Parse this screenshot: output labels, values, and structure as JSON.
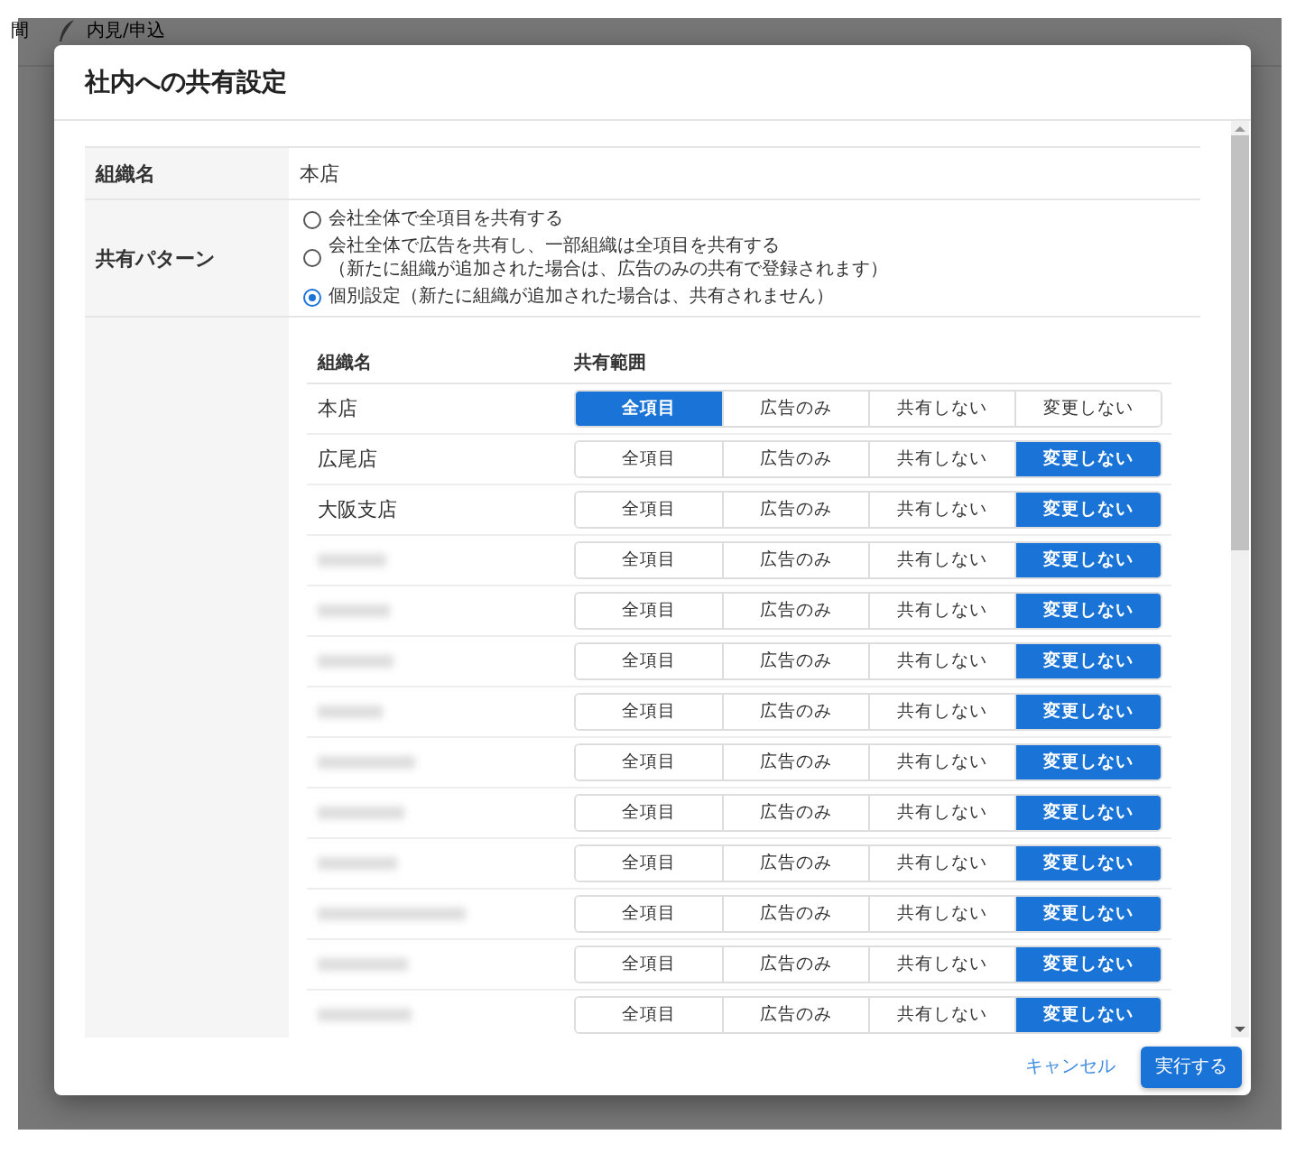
{
  "background": {
    "menu": [
      {
        "label": "間"
      },
      {
        "label": "内見/申込"
      }
    ]
  },
  "dialog": {
    "title": "社内への共有設定",
    "org_label": "組織名",
    "org_value": "本店",
    "pattern_label": "共有パターン",
    "patterns": [
      {
        "label": "会社全体で全項目を共有する",
        "selected": false
      },
      {
        "label": "会社全体で広告を共有し、一部組織は全項目を共有する",
        "note": "（新たに組織が追加された場合は、広告のみの共有で登録されます）",
        "selected": false
      },
      {
        "label": "個別設定（新たに組織が追加された場合は、共有されません）",
        "selected": true
      }
    ],
    "table": {
      "columns": [
        "組織名",
        "共有範囲"
      ],
      "rows": [
        {
          "kind": "named",
          "name": "本店",
          "options": [
            {
              "label": "全項目",
              "selected": true
            },
            {
              "label": "広告のみ",
              "selected": false
            },
            {
              "label": "共有しない",
              "selected": false
            },
            {
              "label": "変更しない",
              "selected": false
            }
          ]
        },
        {
          "kind": "named",
          "name": "広尾店",
          "options": [
            {
              "label": "全項目",
              "selected": false
            },
            {
              "label": "広告のみ",
              "selected": false
            },
            {
              "label": "共有しない",
              "selected": false
            },
            {
              "label": "変更しない",
              "selected": true
            }
          ]
        },
        {
          "kind": "named",
          "name": "大阪支店",
          "options": [
            {
              "label": "全項目",
              "selected": false
            },
            {
              "label": "広告のみ",
              "selected": false
            },
            {
              "label": "共有しない",
              "selected": false
            },
            {
              "label": "変更しない",
              "selected": true
            }
          ]
        },
        {
          "kind": "blurred",
          "options": [
            {
              "label": "全項目",
              "selected": false
            },
            {
              "label": "広告のみ",
              "selected": false
            },
            {
              "label": "共有しない",
              "selected": false
            },
            {
              "label": "変更しない",
              "selected": true
            }
          ]
        },
        {
          "kind": "blurred",
          "options": [
            {
              "label": "全項目",
              "selected": false
            },
            {
              "label": "広告のみ",
              "selected": false
            },
            {
              "label": "共有しない",
              "selected": false
            },
            {
              "label": "変更しない",
              "selected": true
            }
          ]
        },
        {
          "kind": "blurred",
          "options": [
            {
              "label": "全項目",
              "selected": false
            },
            {
              "label": "広告のみ",
              "selected": false
            },
            {
              "label": "共有しない",
              "selected": false
            },
            {
              "label": "変更しない",
              "selected": true
            }
          ]
        },
        {
          "kind": "blurred",
          "options": [
            {
              "label": "全項目",
              "selected": false
            },
            {
              "label": "広告のみ",
              "selected": false
            },
            {
              "label": "共有しない",
              "selected": false
            },
            {
              "label": "変更しない",
              "selected": true
            }
          ]
        },
        {
          "kind": "blurred",
          "options": [
            {
              "label": "全項目",
              "selected": false
            },
            {
              "label": "広告のみ",
              "selected": false
            },
            {
              "label": "共有しない",
              "selected": false
            },
            {
              "label": "変更しない",
              "selected": true
            }
          ]
        },
        {
          "kind": "blurred",
          "options": [
            {
              "label": "全項目",
              "selected": false
            },
            {
              "label": "広告のみ",
              "selected": false
            },
            {
              "label": "共有しない",
              "selected": false
            },
            {
              "label": "変更しない",
              "selected": true
            }
          ]
        },
        {
          "kind": "blurred",
          "options": [
            {
              "label": "全項目",
              "selected": false
            },
            {
              "label": "広告のみ",
              "selected": false
            },
            {
              "label": "共有しない",
              "selected": false
            },
            {
              "label": "変更しない",
              "selected": true
            }
          ]
        },
        {
          "kind": "blurred",
          "options": [
            {
              "label": "全項目",
              "selected": false
            },
            {
              "label": "広告のみ",
              "selected": false
            },
            {
              "label": "共有しない",
              "selected": false
            },
            {
              "label": "変更しない",
              "selected": true
            }
          ]
        },
        {
          "kind": "blurred",
          "options": [
            {
              "label": "全項目",
              "selected": false
            },
            {
              "label": "広告のみ",
              "selected": false
            },
            {
              "label": "共有しない",
              "selected": false
            },
            {
              "label": "変更しない",
              "selected": true
            }
          ]
        },
        {
          "kind": "blurred",
          "options": [
            {
              "label": "全項目",
              "selected": false
            },
            {
              "label": "広告のみ",
              "selected": false
            },
            {
              "label": "共有しない",
              "selected": false
            },
            {
              "label": "変更しない",
              "selected": true
            }
          ]
        }
      ]
    },
    "buttons": [
      {
        "label": "キャンセル",
        "kind": "text"
      },
      {
        "label": "実行する",
        "kind": "primary"
      }
    ]
  }
}
